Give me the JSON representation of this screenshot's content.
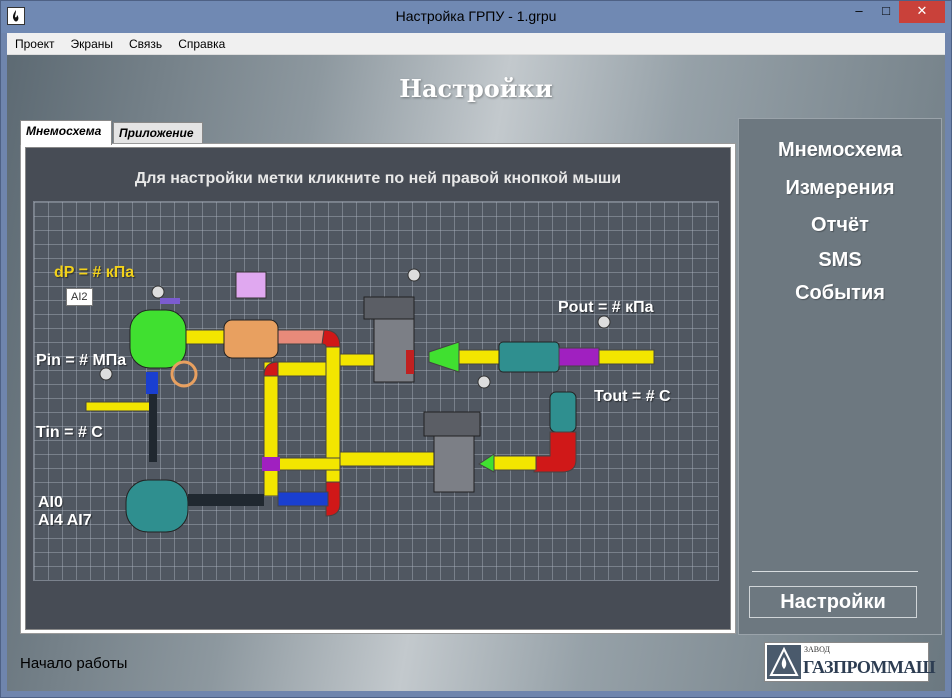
{
  "window": {
    "title": "Настройка ГРПУ - 1.grpu",
    "minimize": "–",
    "maximize": "□",
    "close": "✕"
  },
  "menu": [
    "Проект",
    "Экраны",
    "Связь",
    "Справка"
  ],
  "page_title": "Настройки",
  "tabs": [
    {
      "label": "Мнемосхема",
      "active": true
    },
    {
      "label": "Приложение",
      "active": false
    }
  ],
  "hint": "Для настройки метки кликните по ней правой кнопкой мыши",
  "scheme_labels": {
    "dp": "dP =  # кПа",
    "tooltip": "AI2",
    "pout": "Pout =  # кПа",
    "pin": "Pin =  # МПа",
    "tout": "Tout =  # C",
    "tin": "Tin = # C",
    "ai0": "AI0",
    "ai4_ai7": "AI4 AI7"
  },
  "nav": [
    "Мнемосхема",
    "Измерения",
    "Отчёт",
    "SMS",
    "События"
  ],
  "nav_active": "Настройки",
  "status": "Начало работы",
  "logo": {
    "small": "ЗАВОД",
    "name": "ГАЗПРОММАШ"
  },
  "colors": {
    "pipe_yellow": "#f3e600",
    "pipe_red": "#d01818",
    "pipe_blue": "#1a3fd0",
    "pipe_green": "#40e030",
    "filter_teal": "#2f8f8f",
    "valve_orange": "#e8a060",
    "label_yellow": "#f3d21b"
  }
}
